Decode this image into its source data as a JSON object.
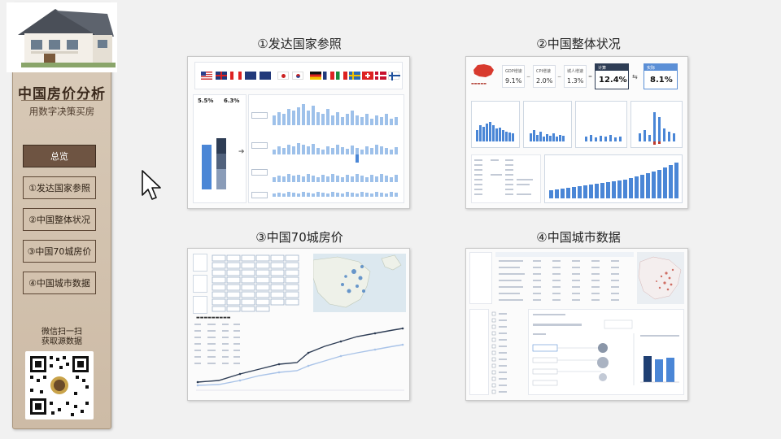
{
  "sidebar": {
    "title": "中国房价分析",
    "subtitle": "用数字决策买房",
    "nav": [
      {
        "label": "总览",
        "active": true
      },
      {
        "label": "①发达国家参照",
        "active": false
      },
      {
        "label": "②中国整体状况",
        "active": false
      },
      {
        "label": "③中国70城房价",
        "active": false
      },
      {
        "label": "④中国城市数据",
        "active": false
      }
    ],
    "qr_caption_line1": "微信扫一扫",
    "qr_caption_line2": "获取源数据"
  },
  "tiles": [
    {
      "title": "①发达国家参照"
    },
    {
      "title": "②中国整体状况"
    },
    {
      "title": "③中国70城房价"
    },
    {
      "title": "④中国城市数据"
    }
  ],
  "tile1": {
    "kpi_left": "5.5%",
    "kpi_right": "6.3%"
  },
  "tile2": {
    "kpis": [
      {
        "label": "GDP增速",
        "value": "9.1%"
      },
      {
        "label": "CPI增速",
        "value": "2.0%"
      },
      {
        "label": "城人增速",
        "value": "1.3%"
      }
    ],
    "highlight1_label": "计算",
    "highlight1_value": "12.4%",
    "highlight2_label": "实际",
    "highlight2_value": "8.1%"
  },
  "colors": {
    "sidebar_bg": "#d4c4b0",
    "nav_active": "#6e5442",
    "chart_blue": "#5b8fd6",
    "accent_dark": "#2e3d55"
  }
}
